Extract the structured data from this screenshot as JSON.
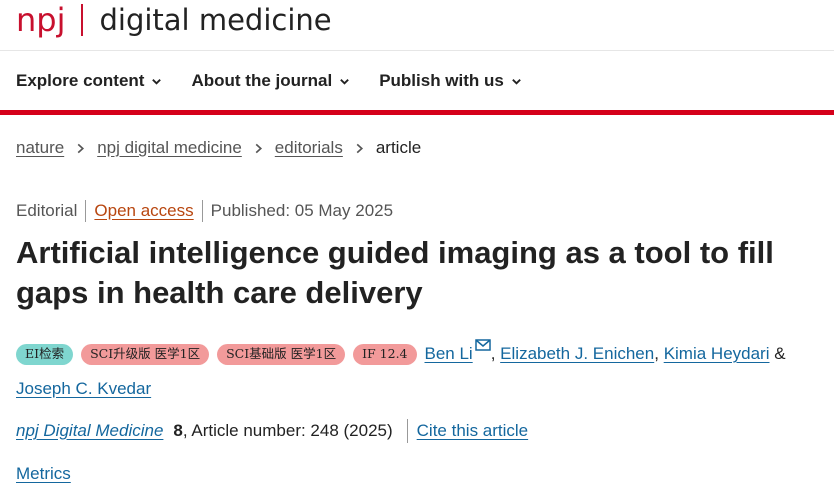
{
  "brand": {
    "npj": "npj",
    "name": "digital medicine"
  },
  "nav": {
    "items": [
      {
        "label": "Explore content"
      },
      {
        "label": "About the journal"
      },
      {
        "label": "Publish with us"
      }
    ]
  },
  "breadcrumb": {
    "items": [
      {
        "label": "nature"
      },
      {
        "label": "npj digital medicine"
      },
      {
        "label": "editorials"
      }
    ],
    "current": "article"
  },
  "meta": {
    "type": "Editorial",
    "access": "Open access",
    "published": "Published: 05 May 2025"
  },
  "article": {
    "title": "Artificial intelligence guided imaging as a tool to fill gaps in health care delivery"
  },
  "badges": {
    "ei": "EI检索",
    "sci_upgrade": "SCI升级版 医学1区",
    "sci_base": "SCI基础版 医学1区",
    "if": "IF 12.4"
  },
  "authors": {
    "a1": "Ben Li",
    "a2": "Elizabeth J. Enichen",
    "a3": "Kimia Heydari",
    "a4": "Joseph C. Kvedar",
    "comma": ",",
    "amp": "&"
  },
  "citation": {
    "journal": "npj Digital Medicine",
    "volume": "8",
    "article_number": ", Article number: 248 (2025)",
    "cite_label": "Cite this article"
  },
  "metrics": {
    "label": "Metrics"
  },
  "colors": {
    "brand_red": "#c8102e",
    "link_blue": "#14679e",
    "open_access": "#b8460f"
  }
}
